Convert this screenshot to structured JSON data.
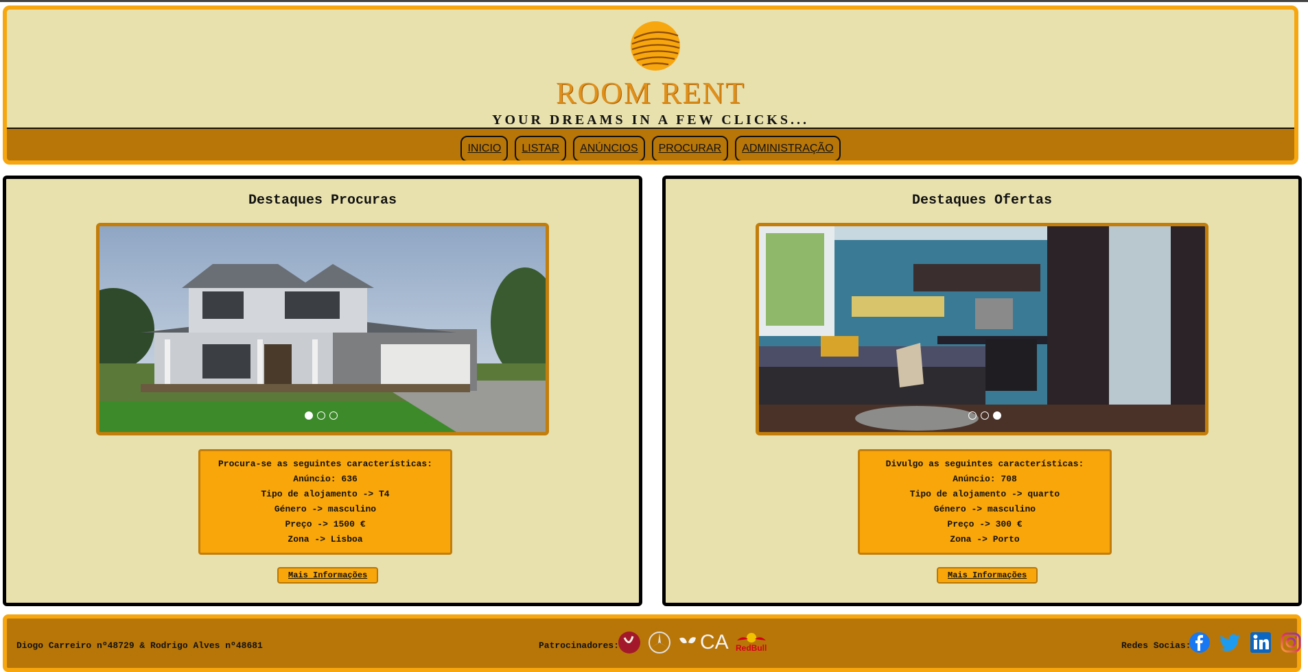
{
  "header": {
    "brand": "ROOM RENT",
    "tagline": "YOUR DREAMS IN A FEW CLICKS...",
    "nav": [
      {
        "label": "INICIO"
      },
      {
        "label": "LISTAR"
      },
      {
        "label": "ANÚNCIOS"
      },
      {
        "label": "PROCURAR"
      },
      {
        "label": "ADMINISTRAÇÃO"
      }
    ]
  },
  "procuras": {
    "title": "Destaques Procuras",
    "active_slide": 1,
    "slides": 3,
    "info": {
      "heading": "Procura-se as seguintes características:",
      "anuncio": "Anúncio: 636",
      "tipo": "Tipo de alojamento -> T4",
      "genero": "Género -> masculino",
      "preco": "Preço -> 1500 €",
      "zona": "Zona -> Lisboa"
    },
    "button": "Mais Informações"
  },
  "ofertas": {
    "title": "Destaques Ofertas",
    "active_slide": 3,
    "slides": 3,
    "info": {
      "heading": "Divulgo as seguintes características:",
      "anuncio": "Anúncio: 708",
      "tipo": "Tipo de alojamento -> quarto",
      "genero": "Género -> masculino",
      "preco": "Preço -> 300 €",
      "zona": "Zona -> Porto"
    },
    "button": "Mais Informações"
  },
  "footer": {
    "authors": "Diogo Carreiro nº48729 & Rodrigo Alves nº48681",
    "sponsors_label": "Patrocinadores:",
    "sponsor_logos": [
      "vodafone-icon",
      "mercedes-icon",
      "ca-icon",
      "redbull-icon"
    ],
    "sponsor_ca_text": "CA",
    "sponsor_redbull_text": "RedBull",
    "socials_label": "Redes Socias:",
    "social_icons": [
      "facebook-icon",
      "twitter-icon",
      "linkedin-icon",
      "instagram-icon"
    ]
  },
  "colors": {
    "background": "#e8e1ae",
    "accent": "#f7a60e",
    "nav": "#b87608"
  }
}
